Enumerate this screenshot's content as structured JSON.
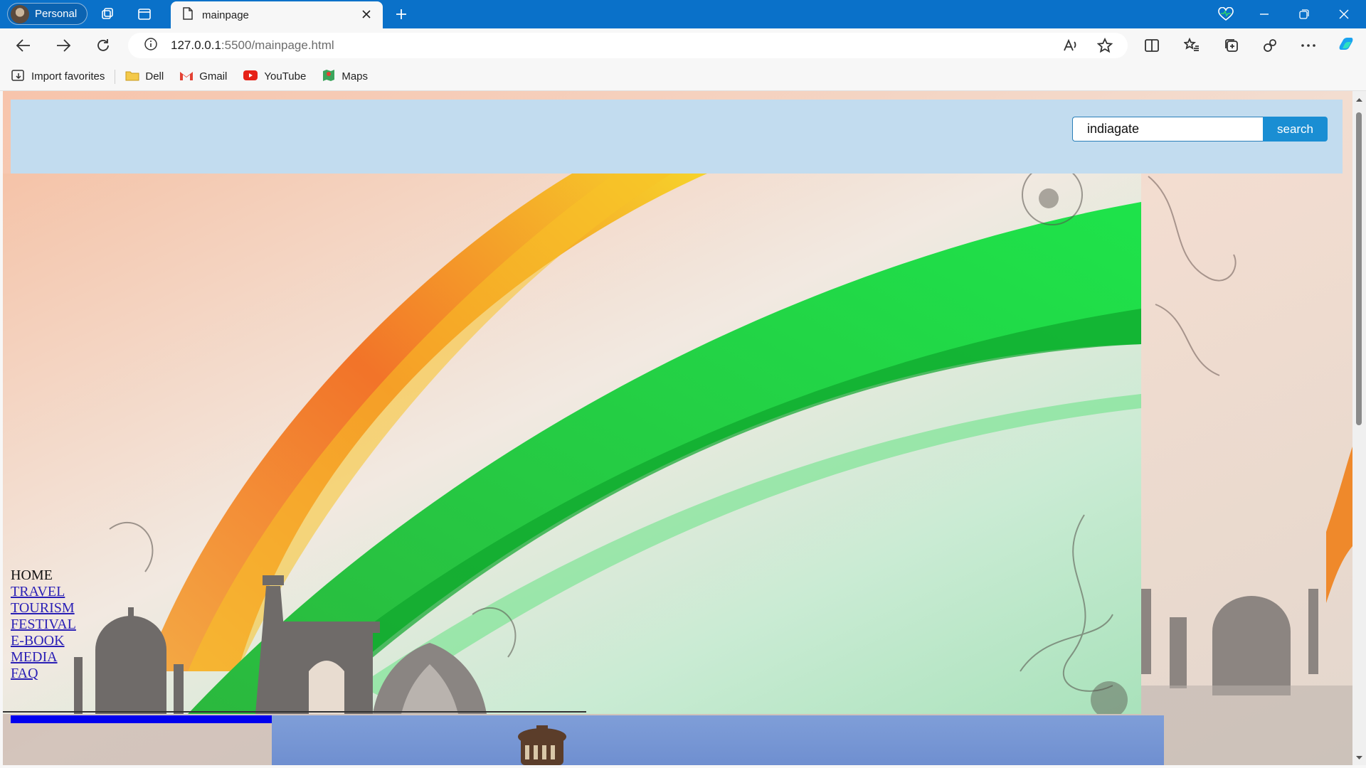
{
  "browser": {
    "profile_label": "Personal",
    "tab_title": "mainpage",
    "url_host": "127.0.0.1",
    "url_rest": ":5500/mainpage.html",
    "favorites": [
      {
        "label": "Import favorites",
        "icon": "import-icon"
      },
      {
        "label": "Dell",
        "icon": "folder-icon"
      },
      {
        "label": "Gmail",
        "icon": "gmail-icon"
      },
      {
        "label": "YouTube",
        "icon": "youtube-icon"
      },
      {
        "label": "Maps",
        "icon": "maps-icon"
      }
    ]
  },
  "header": {
    "search_value": "indiagate",
    "search_button": "search"
  },
  "nav": {
    "home": "HOME",
    "links": [
      "TRAVEL",
      "TOURISM",
      "FESTIVAL",
      "E-BOOK",
      "MEDIA",
      "FAQ"
    ]
  },
  "colors": {
    "titlebar": "#0a71c9",
    "header_bg": "#c2dcef",
    "search_button": "#1a8ed3",
    "saffron": "#f08a1c",
    "green": "#1fbf3a",
    "blue_bar": "#0000ee"
  }
}
